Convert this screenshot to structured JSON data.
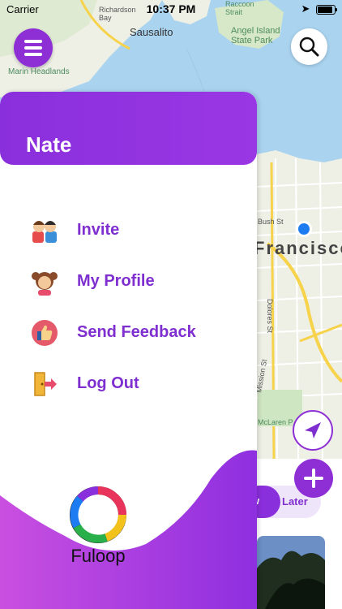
{
  "status_bar": {
    "carrier": "Carrier",
    "time": "10:37 PM"
  },
  "map": {
    "labels": {
      "richardson_bay": "Richardson\nBay",
      "sausalito": "Sausalito",
      "raccoon_strait": "Raccoon\nStrait",
      "angel_island": "Angel Island\nState Park",
      "marin_headlands": "Marin Headlands",
      "francisco": "Francisco",
      "bush_st": "Bush St",
      "dolores_st": "Dolores St",
      "mission_st": "Mission St",
      "mclaren": "McLaren P"
    },
    "colors": {
      "water": "#a9d3ef",
      "land": "#eef0e6",
      "road": "#f7d24b"
    }
  },
  "drawer": {
    "user_name": "Nate",
    "items": [
      {
        "label": "Invite",
        "icon": "invite-friends-icon"
      },
      {
        "label": "My Profile",
        "icon": "profile-girl-icon"
      },
      {
        "label": "Send Feedback",
        "icon": "thumbs-up-icon"
      },
      {
        "label": "Log Out",
        "icon": "logout-door-icon"
      }
    ],
    "logo_text": "Fuloop"
  },
  "segment": {
    "now": "w",
    "later": "Later"
  },
  "colors": {
    "accent": "#8a2fdc",
    "accent_text": "#7f2fd0"
  }
}
